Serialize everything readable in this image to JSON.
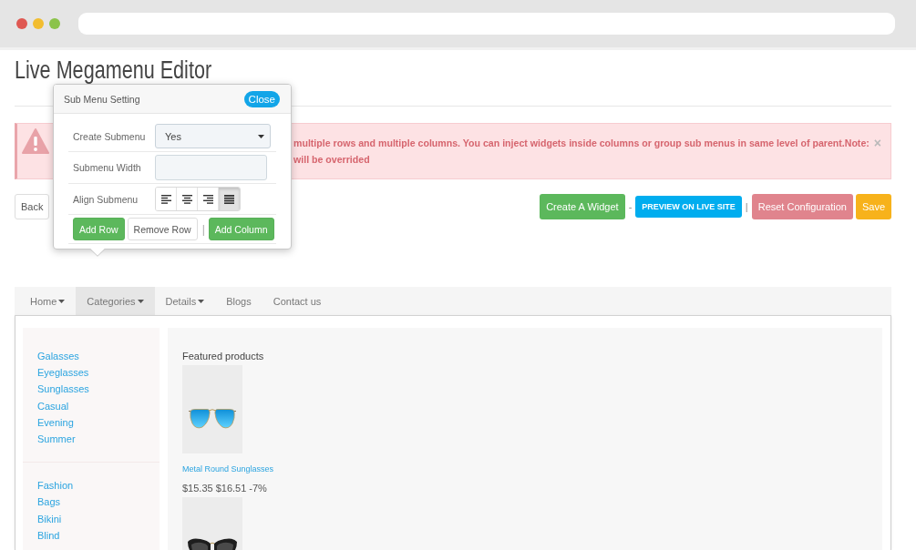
{
  "page": {
    "title": "Live Megamenu Editor"
  },
  "popover": {
    "title": "Sub Menu Setting",
    "close": "Close",
    "fields": [
      {
        "kind": "select",
        "label": "Create Submenu",
        "value": "Yes"
      },
      {
        "kind": "input",
        "label": "Submenu Width"
      },
      {
        "kind": "align",
        "label": "Align Submenu",
        "options": [
          {
            "kind": "left",
            "selected": false
          },
          {
            "kind": "center",
            "selected": false
          },
          {
            "kind": "right",
            "selected": false
          },
          {
            "kind": "justify",
            "selected": true
          }
        ]
      }
    ],
    "actions": [
      {
        "kind": "primary",
        "label": "Add Row"
      },
      {
        "kind": "default",
        "label": "Remove Row"
      },
      {
        "kind": "separator",
        "label": "|"
      },
      {
        "kind": "primary",
        "label": "Add Column"
      }
    ]
  },
  "alert": {
    "lines": [
      "multiple rows and multiple columns. You can inject widgets inside columns or group sub menus in same level of parent.Note:",
      "will be overrided"
    ],
    "close": "×"
  },
  "toolbar": {
    "back": "Back",
    "actions": [
      {
        "kind": "success",
        "label": "Create A Widget"
      },
      {
        "kind": "separator",
        "label": "-"
      },
      {
        "kind": "info",
        "label": "PREVIEW ON LIVE SITE"
      },
      {
        "kind": "separator",
        "label": "|"
      },
      {
        "kind": "danger",
        "label": "Reset Configuration"
      },
      {
        "kind": "warning",
        "label": "Save"
      }
    ]
  },
  "menu": {
    "items": [
      {
        "label": "Home",
        "dropdown": true,
        "selected": false
      },
      {
        "label": "Categories",
        "dropdown": true,
        "selected": true
      },
      {
        "label": "Details",
        "dropdown": true,
        "selected": false
      },
      {
        "label": "Blogs",
        "dropdown": false,
        "selected": false
      },
      {
        "label": "Contact us",
        "dropdown": false,
        "selected": false
      }
    ],
    "columns": [
      {
        "kind": "links",
        "groups": [
          {
            "links": [
              "Galasses",
              "Eyeglasses",
              "Sunglasses",
              "Casual",
              "Evening",
              "Summer"
            ]
          },
          {
            "links": [
              "Fashion",
              "Bags",
              "Bikini",
              "Blind"
            ]
          }
        ]
      },
      {
        "kind": "products",
        "heading": "Featured products",
        "products": [
          {
            "kind": "aviator",
            "name": "Metal Round Sunglasses",
            "price": "$15.35",
            "old_price": "$16.51",
            "discount": "-7%"
          },
          {
            "kind": "cat_eye"
          }
        ]
      }
    ]
  }
}
